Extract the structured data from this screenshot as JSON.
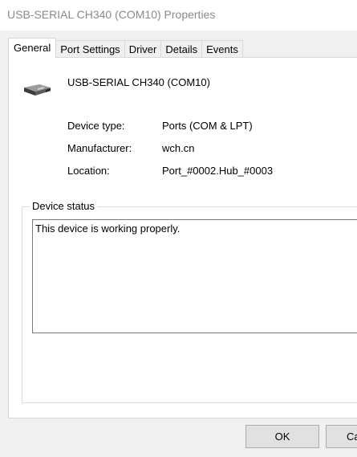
{
  "window": {
    "title": "USB-SERIAL CH340 (COM10) Properties"
  },
  "tabs": [
    {
      "label": "General",
      "active": true
    },
    {
      "label": "Port Settings",
      "active": false
    },
    {
      "label": "Driver",
      "active": false
    },
    {
      "label": "Details",
      "active": false
    },
    {
      "label": "Events",
      "active": false
    }
  ],
  "general": {
    "device_icon": "usb-serial-device-icon",
    "device_name": "USB-SERIAL CH340 (COM10)",
    "properties": [
      {
        "label": "Device type:",
        "value": "Ports (COM & LPT)"
      },
      {
        "label": "Manufacturer:",
        "value": "wch.cn"
      },
      {
        "label": "Location:",
        "value": "Port_#0002.Hub_#0003"
      }
    ],
    "device_status": {
      "caption": "Device status",
      "text": "This device is working properly."
    }
  },
  "buttons": {
    "ok_label": "OK",
    "cancel_label": "Ca"
  }
}
